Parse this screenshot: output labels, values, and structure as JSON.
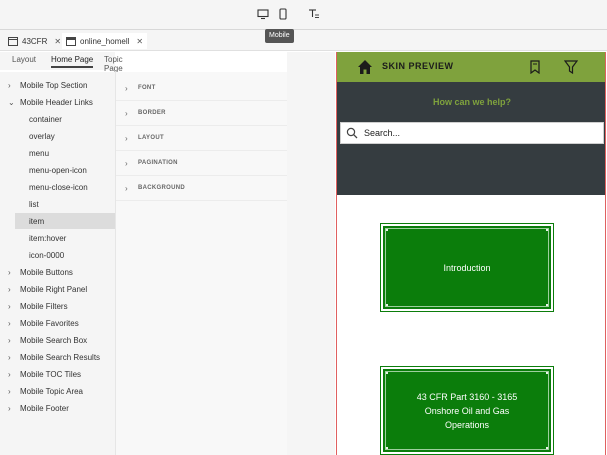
{
  "toolbar": {
    "tooltip": "Mobile",
    "desktop_icon": "monitor-icon",
    "mobile_icon": "phone-icon",
    "text_icon": "text-format-icon"
  },
  "tabs": [
    {
      "label": "43CFR",
      "icon": "document-icon",
      "active": false
    },
    {
      "label": "online_homell",
      "icon": "browser-window-icon",
      "active": true
    }
  ],
  "subtabs": [
    {
      "label": "Layout"
    },
    {
      "label": "Home Page"
    },
    {
      "label": "Topic Page"
    }
  ],
  "tree": {
    "items": [
      {
        "label": "Mobile Top Section",
        "level": 0,
        "expanded": false
      },
      {
        "label": "Mobile Header Links",
        "level": 0,
        "expanded": true
      },
      {
        "label": "container",
        "level": 1
      },
      {
        "label": "overlay",
        "level": 1
      },
      {
        "label": "menu",
        "level": 1
      },
      {
        "label": "menu-open-icon",
        "level": 1
      },
      {
        "label": "menu-close-icon",
        "level": 1
      },
      {
        "label": "list",
        "level": 1
      },
      {
        "label": "item",
        "level": 1,
        "selected": true
      },
      {
        "label": "item:hover",
        "level": 1
      },
      {
        "label": "icon-0000",
        "level": 1
      },
      {
        "label": "Mobile Buttons",
        "level": 0,
        "expanded": false
      },
      {
        "label": "Mobile Right Panel",
        "level": 0,
        "expanded": false
      },
      {
        "label": "Mobile Filters",
        "level": 0,
        "expanded": false
      },
      {
        "label": "Mobile Favorites",
        "level": 0,
        "expanded": false
      },
      {
        "label": "Mobile Search Box",
        "level": 0,
        "expanded": false
      },
      {
        "label": "Mobile Search Results",
        "level": 0,
        "expanded": false
      },
      {
        "label": "Mobile TOC Tiles",
        "level": 0,
        "expanded": false
      },
      {
        "label": "Mobile Topic Area",
        "level": 0,
        "expanded": false
      },
      {
        "label": "Mobile Footer",
        "level": 0,
        "expanded": false
      }
    ]
  },
  "properties": [
    {
      "label": "FONT"
    },
    {
      "label": "BORDER"
    },
    {
      "label": "LAYOUT"
    },
    {
      "label": "PAGINATION"
    },
    {
      "label": "BACKGROUND"
    }
  ],
  "preview": {
    "title": "SKIN PREVIEW",
    "help_text": "How can we help?",
    "search_placeholder": "Search...",
    "tiles": [
      {
        "text": "Introduction"
      },
      {
        "text": "43 CFR Part 3160 - 3165 Onshore Oil and Gas Operations"
      }
    ],
    "colors": {
      "header": "#7fa23d",
      "band": "#353c40",
      "tile": "#0b7d0b",
      "accent_text": "#7fa23d"
    }
  }
}
